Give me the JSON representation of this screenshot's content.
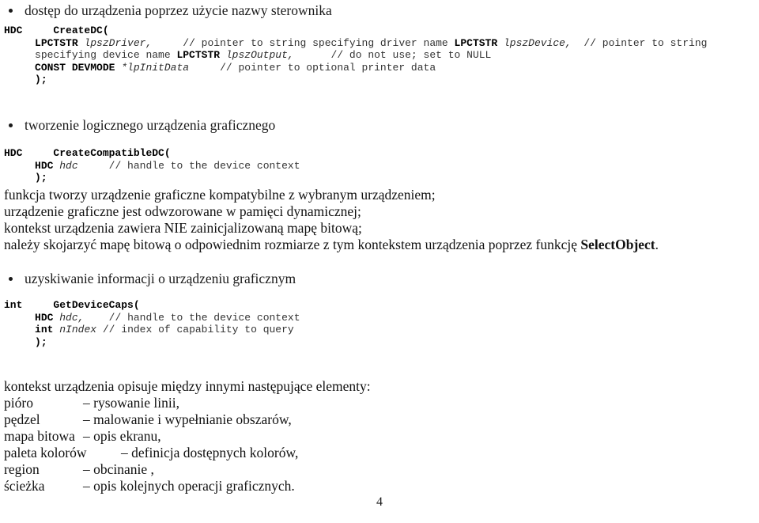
{
  "document": {
    "page_number": "4",
    "sections": [
      {
        "heading": "dostęp do urządzenia poprzez użycie nazwy sterownika",
        "code_lines": [
          [
            {
              "text": "HDC",
              "style": "ret"
            },
            {
              "text": "     ",
              "style": "pl"
            },
            {
              "text": "CreateDC(",
              "style": "fn"
            }
          ],
          [
            {
              "text": "     ",
              "style": "pl"
            },
            {
              "text": "LPCTSTR",
              "style": "kw"
            },
            {
              "text": " ",
              "style": "pl"
            },
            {
              "text": "lpszDriver,",
              "style": "var"
            },
            {
              "text": "     ",
              "style": "pl"
            },
            {
              "text": "// pointer to string specifying driver name ",
              "style": "cmt"
            },
            {
              "text": "LPCTSTR",
              "style": "kw"
            },
            {
              "text": " ",
              "style": "pl"
            },
            {
              "text": "lpszDevice,",
              "style": "var"
            },
            {
              "text": "  ",
              "style": "pl"
            },
            {
              "text": "// pointer to string",
              "style": "cmt"
            }
          ],
          [
            {
              "text": "     ",
              "style": "pl"
            },
            {
              "text": "specifying device name ",
              "style": "cmt"
            },
            {
              "text": "LPCTSTR",
              "style": "kw"
            },
            {
              "text": " ",
              "style": "pl"
            },
            {
              "text": "lpszOutput,",
              "style": "var"
            },
            {
              "text": "      ",
              "style": "pl"
            },
            {
              "text": "// do not use; set to NULL",
              "style": "cmt"
            }
          ],
          [
            {
              "text": "     ",
              "style": "pl"
            },
            {
              "text": "CONST DEVMODE",
              "style": "kw"
            },
            {
              "text": " ",
              "style": "pl"
            },
            {
              "text": "*lpInitData",
              "style": "var"
            },
            {
              "text": "     ",
              "style": "pl"
            },
            {
              "text": "// pointer to optional printer data",
              "style": "cmt"
            }
          ],
          [
            {
              "text": "     ",
              "style": "pl"
            },
            {
              "text": ");",
              "style": "fn"
            }
          ]
        ]
      },
      {
        "heading": "tworzenie logicznego urządzenia graficznego",
        "code_lines": [
          [
            {
              "text": "HDC",
              "style": "ret"
            },
            {
              "text": "     ",
              "style": "pl"
            },
            {
              "text": "CreateCompatibleDC(",
              "style": "fn"
            }
          ],
          [
            {
              "text": "     ",
              "style": "pl"
            },
            {
              "text": "HDC",
              "style": "kw"
            },
            {
              "text": " ",
              "style": "pl"
            },
            {
              "text": "hdc",
              "style": "var"
            },
            {
              "text": "     ",
              "style": "pl"
            },
            {
              "text": "// handle to the device context",
              "style": "cmt"
            }
          ],
          [
            {
              "text": "     ",
              "style": "pl"
            },
            {
              "text": ");",
              "style": "fn"
            }
          ]
        ],
        "prose": [
          {
            "runs": [
              {
                "text": "funkcja tworzy urządzenie graficzne kompatybilne z wybranym urządzeniem;",
                "bold": false
              }
            ]
          },
          {
            "runs": [
              {
                "text": "urządzenie graficzne jest odwzorowane w pamięci dynamicznej;",
                "bold": false
              }
            ]
          },
          {
            "runs": [
              {
                "text": "kontekst urządzenia zawiera NIE zainicjalizowaną mapę bitową;",
                "bold": false
              }
            ]
          },
          {
            "runs": [
              {
                "text": "należy skojarzyć mapę bitową o odpowiednim rozmiarze z tym kontekstem urządzenia poprzez funkcję ",
                "bold": false
              },
              {
                "text": "SelectObject",
                "bold": true
              },
              {
                "text": ".",
                "bold": false
              }
            ]
          }
        ]
      },
      {
        "heading": "uzyskiwanie informacji o urządzeniu graficznym",
        "code_lines": [
          [
            {
              "text": "int",
              "style": "ret"
            },
            {
              "text": "     ",
              "style": "pl"
            },
            {
              "text": "GetDeviceCaps(",
              "style": "fn"
            }
          ],
          [
            {
              "text": "     ",
              "style": "pl"
            },
            {
              "text": "HDC",
              "style": "kw"
            },
            {
              "text": " ",
              "style": "pl"
            },
            {
              "text": "hdc,",
              "style": "var"
            },
            {
              "text": "    ",
              "style": "pl"
            },
            {
              "text": "// handle to the device context",
              "style": "cmt"
            }
          ],
          [
            {
              "text": "     ",
              "style": "pl"
            },
            {
              "text": "int",
              "style": "kw"
            },
            {
              "text": " ",
              "style": "pl"
            },
            {
              "text": "nIndex",
              "style": "var"
            },
            {
              "text": " ",
              "style": "pl"
            },
            {
              "text": "// index of capability to query",
              "style": "cmt"
            }
          ],
          [
            {
              "text": "     ",
              "style": "pl"
            },
            {
              "text": ");",
              "style": "fn"
            }
          ]
        ]
      }
    ],
    "closing": {
      "intro": "kontekst urządzenia opisuje między innymi następujące elementy:",
      "definitions": [
        {
          "term": "pióro",
          "term_width": 100,
          "desc": "– rysowanie linii,"
        },
        {
          "term": "pędzel",
          "term_width": 100,
          "desc": "– malowanie i wypełnianie obszarów,"
        },
        {
          "term": "mapa bitowa",
          "term_width": 100,
          "desc": "– opis ekranu,"
        },
        {
          "term": "paleta kolorów",
          "term_width": 148,
          "desc": "– definicja dostępnych kolorów,"
        },
        {
          "term": "region",
          "term_width": 100,
          "desc": "– obcinanie ,"
        },
        {
          "term": "ścieżka",
          "term_width": 100,
          "desc": "– opis kolejnych operacji graficznych."
        }
      ]
    }
  }
}
